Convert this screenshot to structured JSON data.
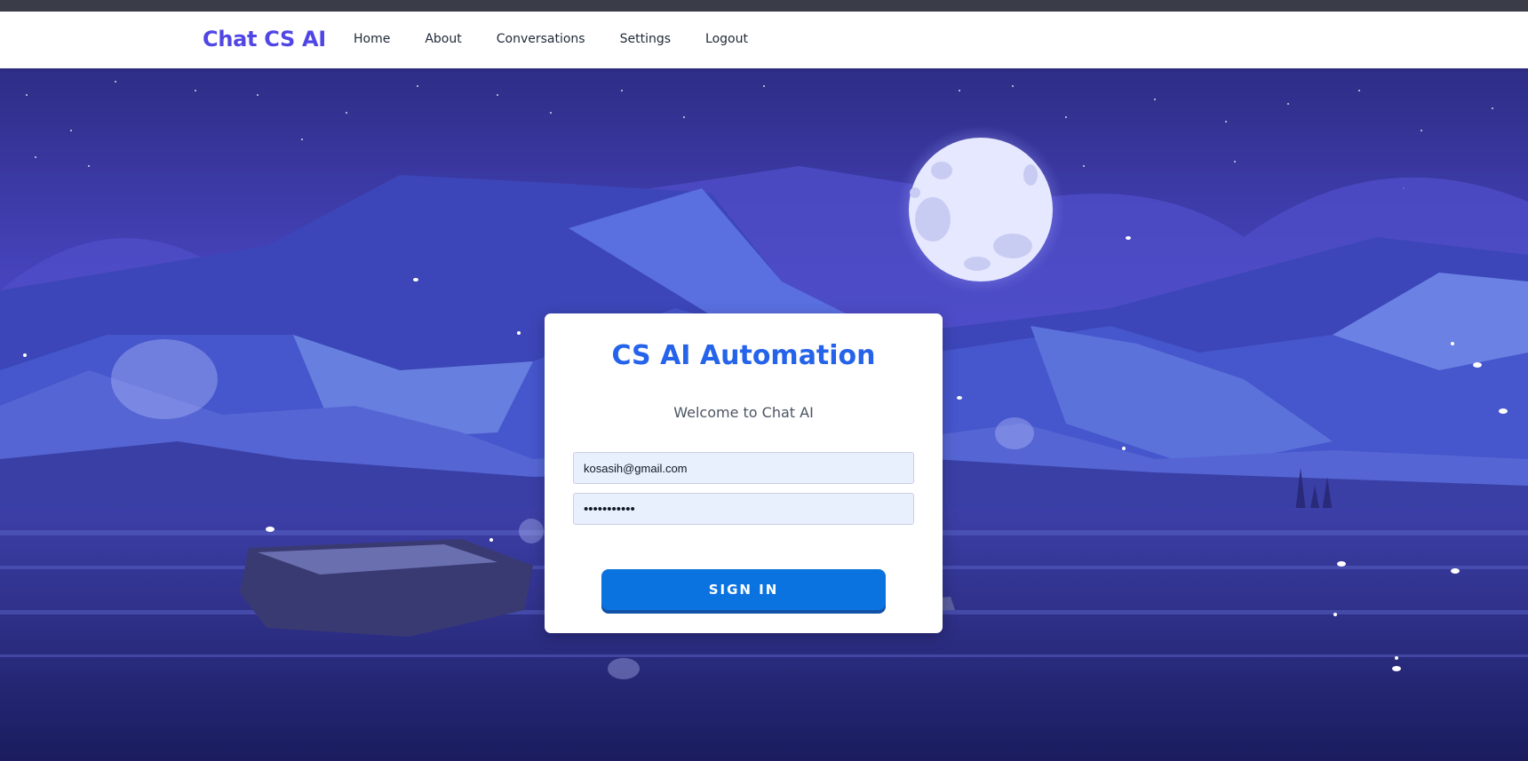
{
  "navbar": {
    "brand": "Chat CS AI",
    "links": [
      {
        "label": "Home"
      },
      {
        "label": "About"
      },
      {
        "label": "Conversations"
      },
      {
        "label": "Settings"
      },
      {
        "label": "Logout"
      }
    ]
  },
  "login": {
    "title": "CS AI Automation",
    "subtitle": "Welcome to Chat AI",
    "email_value": "kosasih@gmail.com",
    "password_value": "kosasih1234",
    "signin_label": "SIGN IN"
  },
  "colors": {
    "brand": "#4f46e5",
    "title": "#2563eb",
    "button": "#0b73e0",
    "input_bg": "#e8f0fe"
  }
}
